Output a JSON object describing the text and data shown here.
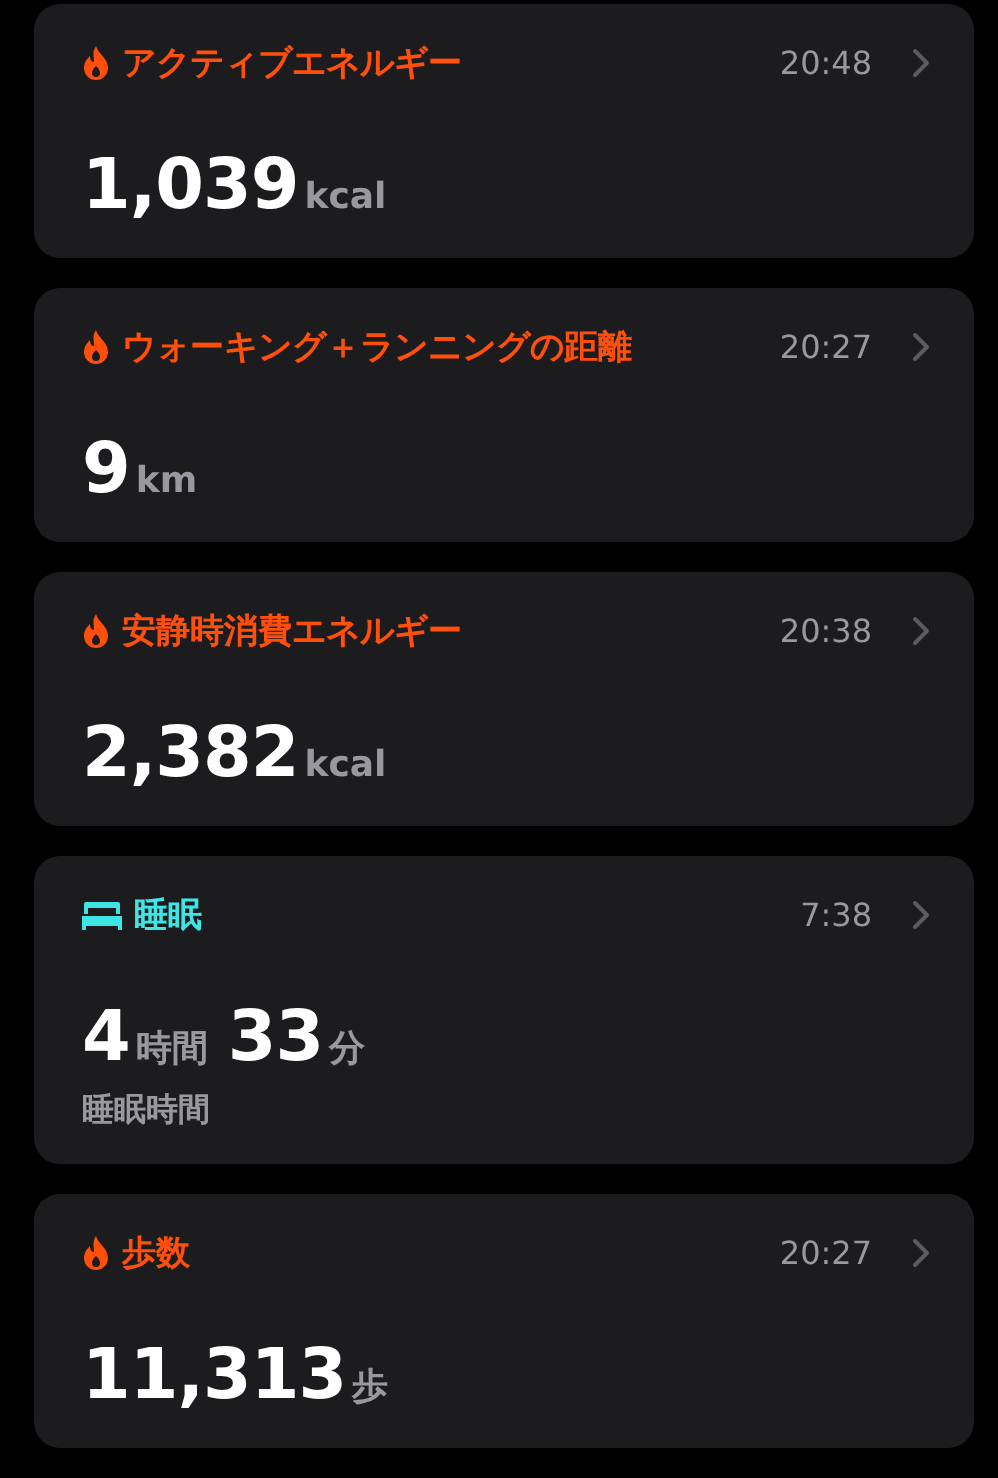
{
  "cards": [
    {
      "kind": "flame",
      "color": "#ff4f0a",
      "title": "アクティブエネルギー",
      "time": "20:48",
      "value": [
        {
          "number": "1,039",
          "unit": "kcal"
        }
      ]
    },
    {
      "kind": "flame",
      "color": "#ff4f0a",
      "title": "ウォーキング＋ランニングの距離",
      "time": "20:27",
      "value": [
        {
          "number": "9",
          "unit": "km"
        }
      ]
    },
    {
      "kind": "flame",
      "color": "#ff4f0a",
      "title": "安静時消費エネルギー",
      "time": "20:38",
      "value": [
        {
          "number": "2,382",
          "unit": "kcal"
        }
      ]
    },
    {
      "kind": "bed",
      "color": "#3fe5e5",
      "title": "睡眠",
      "time": "7:38",
      "value": [
        {
          "number": "4",
          "unit": "時間"
        },
        {
          "number": "33",
          "unit": "分"
        }
      ],
      "subtitle": "睡眠時間"
    },
    {
      "kind": "flame",
      "color": "#ff4f0a",
      "title": "歩数",
      "time": "20:27",
      "value": [
        {
          "number": "11,313",
          "unit": "歩"
        }
      ]
    }
  ]
}
